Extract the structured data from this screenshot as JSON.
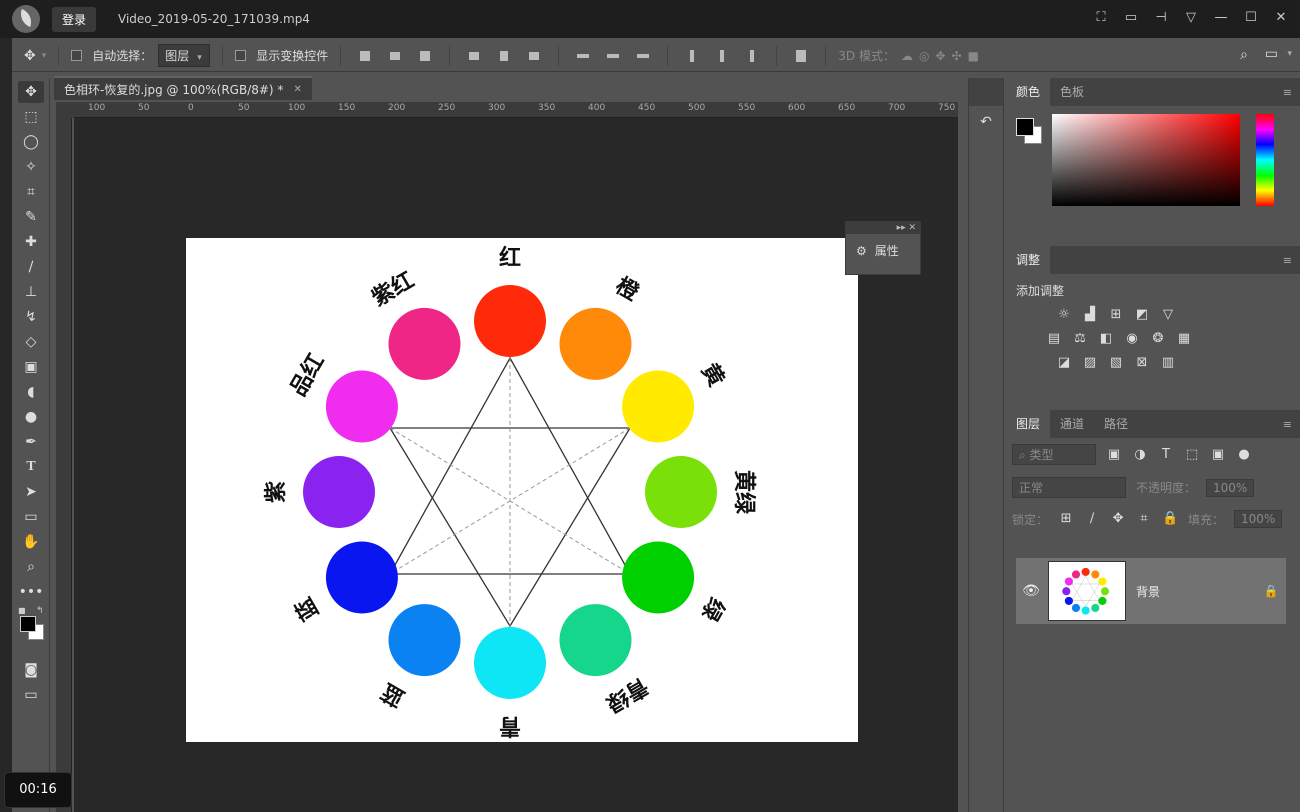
{
  "player": {
    "login_label": "登录",
    "title": "Video_2019-05-20_171039.mp4"
  },
  "options": {
    "auto_select_label": "自动选择：",
    "layer_select_value": "图层",
    "show_transform_label": "显示变换控件",
    "mode_3d_label": "3D 模式："
  },
  "document": {
    "tab_title": "色相环-恢复的.jpg @ 100%(RGB/8#) *",
    "ruler_ticks": [
      "100",
      "50",
      "0",
      "50",
      "100",
      "150",
      "200",
      "250",
      "300",
      "350",
      "400",
      "450",
      "500",
      "550",
      "600",
      "650",
      "700",
      "750"
    ]
  },
  "properties_panel": {
    "label": "属性"
  },
  "color_wheel": {
    "segments": [
      {
        "label": "红",
        "color": "#ff2a0a"
      },
      {
        "label": "橙",
        "color": "#ff8a0a"
      },
      {
        "label": "黄",
        "color": "#ffea00"
      },
      {
        "label": "黄绿",
        "color": "#7ae00a"
      },
      {
        "label": "绿",
        "color": "#00d000"
      },
      {
        "label": "青绿",
        "color": "#16d68c"
      },
      {
        "label": "青",
        "color": "#0ee6f6"
      },
      {
        "label": "蓝",
        "color": "#0a82f2"
      },
      {
        "label": "蓝",
        "color": "#0a16f0"
      },
      {
        "label": "紫",
        "color": "#8a22f0"
      },
      {
        "label": "品红",
        "color": "#f02cee"
      },
      {
        "label": "紫红",
        "color": "#f02686"
      }
    ]
  },
  "panels": {
    "color_tab": "颜色",
    "swatches_tab": "色板",
    "adjust_tab": "调整",
    "adjust_title": "添加调整",
    "layers_tab": "图层",
    "channels_tab": "通道",
    "paths_tab": "路径",
    "filter_placeholder": "类型",
    "blend_mode": "正常",
    "opacity_label": "不透明度：",
    "opacity_value": "100%",
    "lock_label": "锁定：",
    "fill_label": "填充：",
    "fill_value": "100%",
    "layer_name": "背景"
  },
  "timecode": "00:16"
}
